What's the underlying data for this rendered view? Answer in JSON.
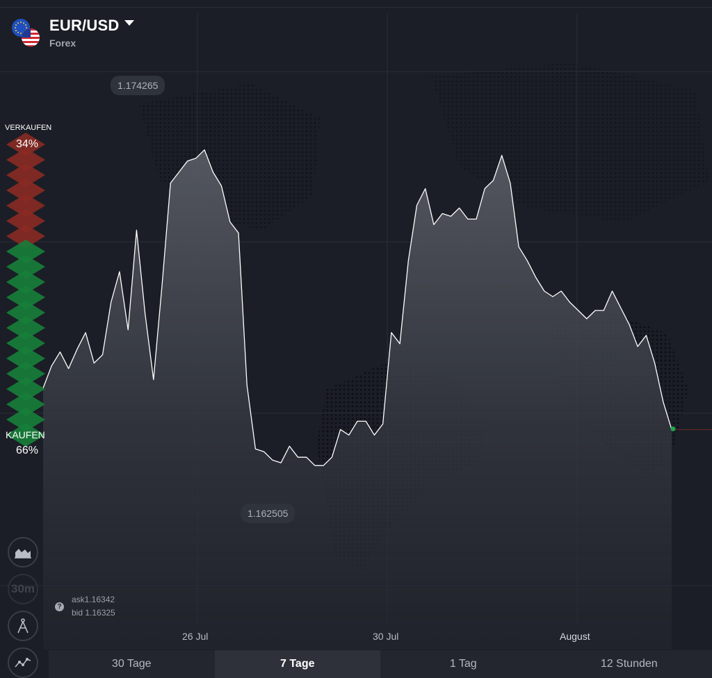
{
  "asset": {
    "title": "EUR/USD",
    "type": "Forex"
  },
  "sentiment": {
    "sell_label": "VERKAUFEN",
    "sell_pct": "34%",
    "sell_fraction": 0.34,
    "buy_label": "KAUFEN",
    "buy_pct": "66%",
    "buy_fraction": 0.66
  },
  "extremes": {
    "high": "1.174265",
    "low": "1.162505"
  },
  "quote": {
    "ask": "ask1.16342",
    "bid": "bid 1.16325"
  },
  "side_tools": [
    {
      "icon": "area-chart-icon"
    },
    {
      "label": "30m"
    },
    {
      "icon": "drawing-compass-icon"
    },
    {
      "icon": "indicators-icon"
    }
  ],
  "x_labels": [
    "26 Jul",
    "30 Jul",
    "August"
  ],
  "timeframes": [
    {
      "label": "30 Tage",
      "active": false
    },
    {
      "label": "7 Tage",
      "active": true
    },
    {
      "label": "1 Tag",
      "active": false
    },
    {
      "label": "12 Stunden",
      "active": false
    }
  ],
  "colors": {
    "sell": "#8a2a24",
    "buy": "#17803a",
    "line": "#ffffff",
    "current_dot": "#1fa44a",
    "current_line": "#c0392b"
  },
  "chart_data": {
    "type": "area",
    "series": [
      {
        "values": [
          1.1655,
          1.1663,
          1.1668,
          1.1662,
          1.1669,
          1.1675,
          1.1664,
          1.1667,
          1.1686,
          1.1697,
          1.1676,
          1.1712,
          1.1682,
          1.1658,
          1.1692,
          1.1729,
          1.1733,
          1.1737,
          1.1738,
          1.1741,
          1.1733,
          1.1728,
          1.1715,
          1.1711,
          1.1656,
          1.1633,
          1.1632,
          1.1629,
          1.1628,
          1.1634,
          1.163,
          1.163,
          1.1627,
          1.1627,
          1.163,
          1.164,
          1.1638,
          1.1643,
          1.1643,
          1.1638,
          1.1642,
          1.1675,
          1.1671,
          1.1701,
          1.1721,
          1.1727,
          1.1714,
          1.1718,
          1.1717,
          1.172,
          1.1716,
          1.1716,
          1.1727,
          1.173,
          1.1739,
          1.1729,
          1.1706,
          1.1701,
          1.1695,
          1.169,
          1.1688,
          1.169,
          1.1686,
          1.1683,
          1.168,
          1.1683,
          1.1683,
          1.169,
          1.1684,
          1.1678,
          1.167,
          1.1674,
          1.1664,
          1.165,
          1.164
        ]
      }
    ],
    "ylim": [
      1.1615,
      1.176
    ]
  }
}
